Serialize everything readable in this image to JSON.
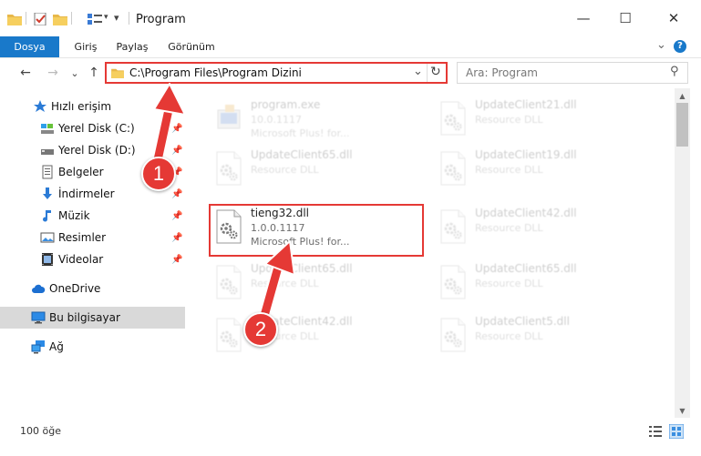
{
  "window": {
    "title": "Program",
    "minimize": "—",
    "maximize": "☐",
    "close": "✕"
  },
  "ribbon": {
    "tabs": [
      {
        "label": "Dosya",
        "active": true
      },
      {
        "label": "Giriş",
        "active": false
      },
      {
        "label": "Paylaş",
        "active": false
      },
      {
        "label": "Görünüm",
        "active": false
      }
    ],
    "expand": "⌄",
    "help": "?"
  },
  "nav": {
    "back": "←",
    "forward": "→",
    "recent": "⌄",
    "up": "↑",
    "address": "C:\\Program Files\\Program Dizini",
    "address_dropdown": "⌄",
    "refresh": "↻",
    "search_placeholder": "Ara: Program",
    "search_icon": "⚲"
  },
  "sidebar": {
    "quick_access": "Hızlı erişim",
    "items": [
      {
        "label": "Yerel Disk (C:)",
        "icon": "drive-icon"
      },
      {
        "label": "Yerel Disk (D:)",
        "icon": "drive-icon"
      },
      {
        "label": "Belgeler",
        "icon": "documents-icon"
      },
      {
        "label": "İndirmeler",
        "icon": "downloads-icon"
      },
      {
        "label": "Müzik",
        "icon": "music-icon"
      },
      {
        "label": "Resimler",
        "icon": "pictures-icon"
      },
      {
        "label": "Videolar",
        "icon": "videos-icon"
      }
    ],
    "onedrive": "OneDrive",
    "this_pc": "Bu bilgisayar",
    "network": "Ağ",
    "pin": "📌"
  },
  "files": [
    {
      "name": "program.exe",
      "l1": "10.0.1117",
      "l2": "Microsoft Plus! for...",
      "type": "exe",
      "faded": true
    },
    {
      "name": "UpdateClient21.dll",
      "l1": "Resource DLL",
      "l2": "",
      "type": "dll",
      "faded": true
    },
    {
      "name": "UpdateClient65.dll",
      "l1": "Resource DLL",
      "l2": "",
      "type": "dll",
      "faded": true
    },
    {
      "name": "UpdateClient19.dll",
      "l1": "Resource DLL",
      "l2": "",
      "type": "dll",
      "faded": true
    },
    {
      "name": "tieng32.dll",
      "l1": "1.0.0.1117",
      "l2": "Microsoft Plus! for...",
      "type": "dll",
      "faded": false
    },
    {
      "name": "UpdateClient42.dll",
      "l1": "Resource DLL",
      "l2": "",
      "type": "dll",
      "faded": true
    },
    {
      "name": "UpdateClient65.dll",
      "l1": "Resource DLL",
      "l2": "",
      "type": "dll",
      "faded": true
    },
    {
      "name": "UpdateClient65.dll",
      "l1": "Resource DLL",
      "l2": "",
      "type": "dll",
      "faded": true
    },
    {
      "name": "UpdateClient42.dll",
      "l1": "Resource DLL",
      "l2": "",
      "type": "dll",
      "faded": true
    },
    {
      "name": "UpdateClient5.dll",
      "l1": "Resource DLL",
      "l2": "",
      "type": "dll",
      "faded": true
    }
  ],
  "status": {
    "count": "100 öğe"
  },
  "callouts": {
    "one": "1",
    "two": "2"
  },
  "colors": {
    "accent": "#1979ca",
    "highlight": "#e53935"
  }
}
